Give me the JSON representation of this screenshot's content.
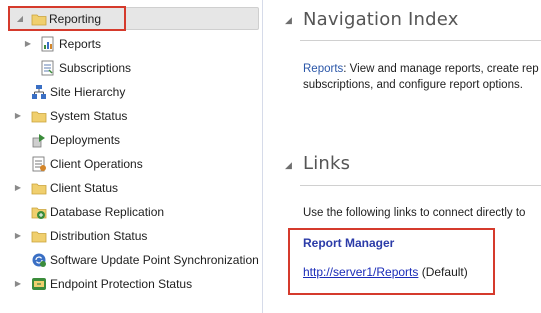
{
  "tree": {
    "items": [
      {
        "label": "Reporting",
        "icon": "folder-icon",
        "expander": "expanded"
      },
      {
        "label": "Reports",
        "icon": "report-icon",
        "expander": "collapsed"
      },
      {
        "label": "Subscriptions",
        "icon": "subscription-icon",
        "expander": "none"
      },
      {
        "label": "Site Hierarchy",
        "icon": "hierarchy-icon",
        "expander": "none"
      },
      {
        "label": "System Status",
        "icon": "folder-icon",
        "expander": "collapsed"
      },
      {
        "label": "Deployments",
        "icon": "deployment-icon",
        "expander": "none"
      },
      {
        "label": "Client Operations",
        "icon": "client-operations-icon",
        "expander": "none"
      },
      {
        "label": "Client Status",
        "icon": "folder-icon",
        "expander": "collapsed"
      },
      {
        "label": "Database Replication",
        "icon": "database-replication-icon",
        "expander": "none"
      },
      {
        "label": "Distribution Status",
        "icon": "folder-icon",
        "expander": "collapsed"
      },
      {
        "label": "Software Update Point Synchronization",
        "icon": "software-update-icon",
        "expander": "none"
      },
      {
        "label": "Endpoint Protection Status",
        "icon": "endpoint-protection-icon",
        "expander": "collapsed"
      }
    ]
  },
  "content": {
    "nav_title": "Navigation Index",
    "nav_desc_bold": "Reports",
    "nav_desc_line1": ": View and manage reports, create rep",
    "nav_desc_line2": "subscriptions, and configure report options.",
    "links_title": "Links",
    "links_desc": "Use the following links to connect directly to",
    "report_manager_label": "Report Manager",
    "report_manager_url": "http://server1/Reports",
    "report_manager_suffix": " (Default)"
  },
  "colors": {
    "highlight_box": "#d53a2c",
    "link": "#1a2bb8",
    "accent_text": "#2a56a8",
    "folder": "#e8c15a"
  }
}
